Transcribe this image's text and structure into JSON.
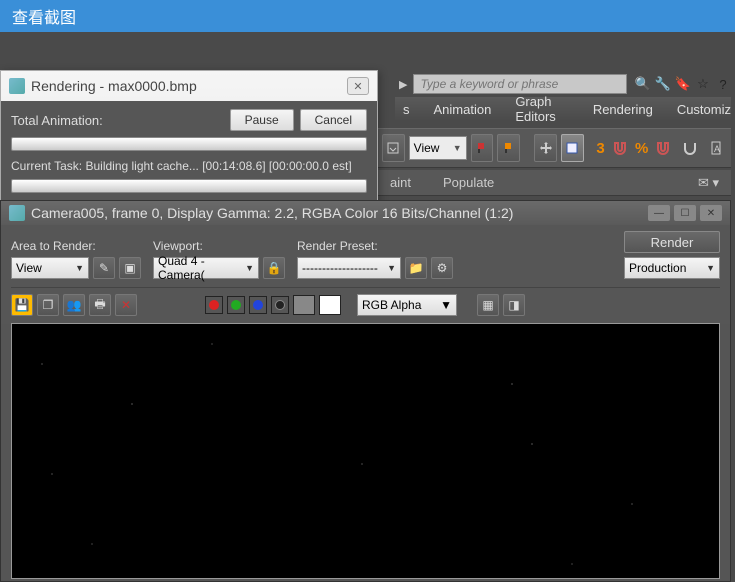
{
  "titlebar": {
    "title": "查看截图"
  },
  "search": {
    "placeholder": "Type a keyword or phrase"
  },
  "menus": {
    "animation": "Animation",
    "graph": "Graph Editors",
    "rendering": "Rendering",
    "customize": "Customiz"
  },
  "toolbar": {
    "view_label": "View"
  },
  "second_tb": {
    "paint": "aint",
    "populate": "Populate"
  },
  "rendering_dialog": {
    "title": "Rendering - max0000.bmp",
    "total_animation": "Total Animation:",
    "pause": "Pause",
    "cancel": "Cancel",
    "current_task": "Current Task:   Building light cache... [00:14:08.6] [00:00:00.0 est]"
  },
  "framebuffer": {
    "title": "Camera005, frame 0, Display Gamma: 2.2, RGBA Color 16 Bits/Channel (1:2)",
    "area_label": "Area to Render:",
    "area_value": "View",
    "viewport_label": "Viewport:",
    "viewport_value": "Quad 4 - Camera(",
    "preset_label": "Render Preset:",
    "preset_value": "-------------------",
    "render_btn": "Render",
    "production": "Production",
    "channel": "RGB Alpha"
  }
}
